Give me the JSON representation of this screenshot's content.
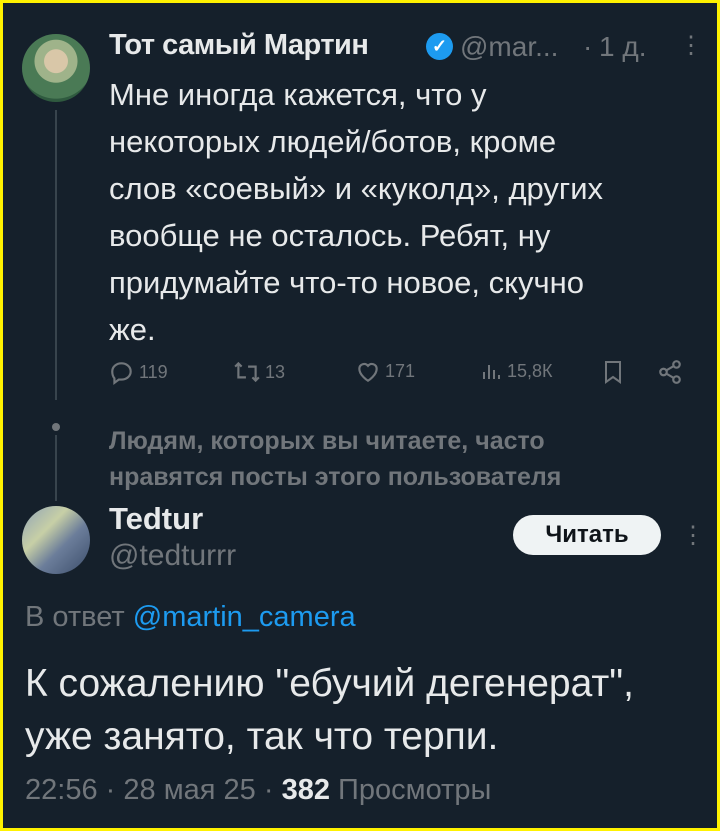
{
  "parent_tweet": {
    "author_name": "Тот самый Мартин",
    "handle": "@mar...",
    "separator": "·",
    "time": "1 д.",
    "more": "⋮",
    "text": "Мне иногда кажется, что у\nнекоторых людей/ботов, кроме\nслов «соевый» и «куколд», других\nвообще не осталось. Ребят, ну\nпридумайте что-то новое, скучно\nже.",
    "actions": {
      "replies": "119",
      "retweets": "13",
      "likes": "171",
      "views": "15,8К"
    }
  },
  "social_context": "Людям, которых вы читаете, часто\nнравятся посты этого пользователя",
  "reply_tweet": {
    "author_name": "Tedtur",
    "handle": "@tedturrr",
    "follow_label": "Читать",
    "more": "⋮",
    "reply_prefix": "В ответ",
    "reply_to": "@martin_camera",
    "text": "К сожалению \"ебучий дегенерат\",\nуже занято, так что терпи.",
    "time": "22:56",
    "sep_a": "·",
    "date": "28 мая 25",
    "sep_b": "·",
    "views_count": "382",
    "views_label": "Просмотры"
  },
  "colors": {
    "background": "#15202b",
    "accent": "#1d9bf0",
    "muted": "#71767b",
    "border": "#fff200"
  }
}
